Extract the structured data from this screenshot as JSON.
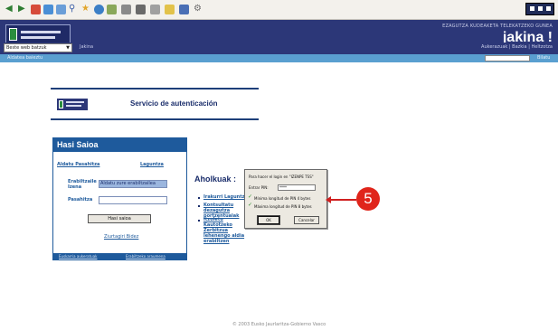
{
  "browser": {
    "toolbar_icons": [
      "back-icon",
      "forward-icon",
      "stop-icon",
      "refresh-icon",
      "home-icon",
      "search-icon",
      "favorites-icon",
      "media-icon",
      "history-icon",
      "mail-icon",
      "print-icon",
      "edit-icon",
      "discuss-icon",
      "messenger-icon"
    ]
  },
  "header": {
    "subtitle": "EZAGUTZA KUDEAKETA TELEKATZEKO GUNEA",
    "brand": "jakina !"
  },
  "search_row": {
    "select_value": "Beste web batzuk",
    "link": "Jakina",
    "right_links": "Aukerazuak | Bazkia | Heltzotza"
  },
  "navbar": {
    "left_label": "Aldatea baieztu",
    "right_label": "Bilatu"
  },
  "auth": {
    "title": "Servicio de autenticación"
  },
  "login": {
    "title": "Hasi Saioa",
    "link_left": "Aldatu Pasahitza",
    "link_right": "Laguntza",
    "user_label": "Erabiltzaile Izena",
    "user_value": "Aldatu zure erabiltzailea",
    "pass_label": "Pasahitza",
    "button": "Hasi saioa",
    "forgot_link": "Ziurtagiri Bidez",
    "footer_left": "Euskarria aukeratuak",
    "footer_right": "Erabiltzeko araumena"
  },
  "advice": {
    "title": "Aholkuak :",
    "items": [
      "Irakurri Laguntza",
      "Kontsultatu dezagutza portzentualak",
      "Itzuletu Kautotzeko Zerbitzua lehenengo aldia erabiltzen"
    ]
  },
  "dialog": {
    "prompt": "Para hacer el login en \"IZENPE TSS\"",
    "pin_label": "Entrar PIN:",
    "pin_value": "****",
    "check1": "Mínima longitud de PIN 4 bytes",
    "check2": "Máxima longitud de PIN 8 bytes",
    "ok": "OK",
    "cancel": "Cancelar"
  },
  "callout": {
    "number": "5",
    "color": "#e0251b"
  },
  "footer": {
    "copyright": "© 2003 Eusko Jaurlaritza-Gobierno Vasco"
  },
  "colors": {
    "header": "#2c3778",
    "nav": "#5a9fd0",
    "login_accent": "#1e5a9c"
  }
}
